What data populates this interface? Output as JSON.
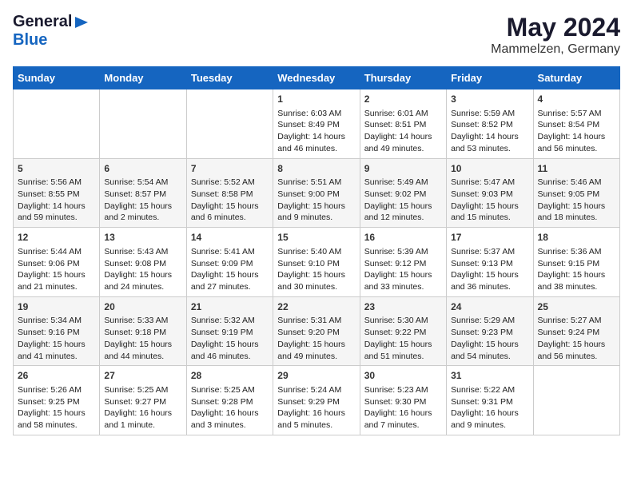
{
  "logo": {
    "general": "General",
    "blue": "Blue"
  },
  "title": "May 2024",
  "subtitle": "Mammelzen, Germany",
  "days_of_week": [
    "Sunday",
    "Monday",
    "Tuesday",
    "Wednesday",
    "Thursday",
    "Friday",
    "Saturday"
  ],
  "weeks": [
    [
      {
        "day": "",
        "info": ""
      },
      {
        "day": "",
        "info": ""
      },
      {
        "day": "",
        "info": ""
      },
      {
        "day": "1",
        "info": "Sunrise: 6:03 AM\nSunset: 8:49 PM\nDaylight: 14 hours and 46 minutes."
      },
      {
        "day": "2",
        "info": "Sunrise: 6:01 AM\nSunset: 8:51 PM\nDaylight: 14 hours and 49 minutes."
      },
      {
        "day": "3",
        "info": "Sunrise: 5:59 AM\nSunset: 8:52 PM\nDaylight: 14 hours and 53 minutes."
      },
      {
        "day": "4",
        "info": "Sunrise: 5:57 AM\nSunset: 8:54 PM\nDaylight: 14 hours and 56 minutes."
      }
    ],
    [
      {
        "day": "5",
        "info": "Sunrise: 5:56 AM\nSunset: 8:55 PM\nDaylight: 14 hours and 59 minutes."
      },
      {
        "day": "6",
        "info": "Sunrise: 5:54 AM\nSunset: 8:57 PM\nDaylight: 15 hours and 2 minutes."
      },
      {
        "day": "7",
        "info": "Sunrise: 5:52 AM\nSunset: 8:58 PM\nDaylight: 15 hours and 6 minutes."
      },
      {
        "day": "8",
        "info": "Sunrise: 5:51 AM\nSunset: 9:00 PM\nDaylight: 15 hours and 9 minutes."
      },
      {
        "day": "9",
        "info": "Sunrise: 5:49 AM\nSunset: 9:02 PM\nDaylight: 15 hours and 12 minutes."
      },
      {
        "day": "10",
        "info": "Sunrise: 5:47 AM\nSunset: 9:03 PM\nDaylight: 15 hours and 15 minutes."
      },
      {
        "day": "11",
        "info": "Sunrise: 5:46 AM\nSunset: 9:05 PM\nDaylight: 15 hours and 18 minutes."
      }
    ],
    [
      {
        "day": "12",
        "info": "Sunrise: 5:44 AM\nSunset: 9:06 PM\nDaylight: 15 hours and 21 minutes."
      },
      {
        "day": "13",
        "info": "Sunrise: 5:43 AM\nSunset: 9:08 PM\nDaylight: 15 hours and 24 minutes."
      },
      {
        "day": "14",
        "info": "Sunrise: 5:41 AM\nSunset: 9:09 PM\nDaylight: 15 hours and 27 minutes."
      },
      {
        "day": "15",
        "info": "Sunrise: 5:40 AM\nSunset: 9:10 PM\nDaylight: 15 hours and 30 minutes."
      },
      {
        "day": "16",
        "info": "Sunrise: 5:39 AM\nSunset: 9:12 PM\nDaylight: 15 hours and 33 minutes."
      },
      {
        "day": "17",
        "info": "Sunrise: 5:37 AM\nSunset: 9:13 PM\nDaylight: 15 hours and 36 minutes."
      },
      {
        "day": "18",
        "info": "Sunrise: 5:36 AM\nSunset: 9:15 PM\nDaylight: 15 hours and 38 minutes."
      }
    ],
    [
      {
        "day": "19",
        "info": "Sunrise: 5:34 AM\nSunset: 9:16 PM\nDaylight: 15 hours and 41 minutes."
      },
      {
        "day": "20",
        "info": "Sunrise: 5:33 AM\nSunset: 9:18 PM\nDaylight: 15 hours and 44 minutes."
      },
      {
        "day": "21",
        "info": "Sunrise: 5:32 AM\nSunset: 9:19 PM\nDaylight: 15 hours and 46 minutes."
      },
      {
        "day": "22",
        "info": "Sunrise: 5:31 AM\nSunset: 9:20 PM\nDaylight: 15 hours and 49 minutes."
      },
      {
        "day": "23",
        "info": "Sunrise: 5:30 AM\nSunset: 9:22 PM\nDaylight: 15 hours and 51 minutes."
      },
      {
        "day": "24",
        "info": "Sunrise: 5:29 AM\nSunset: 9:23 PM\nDaylight: 15 hours and 54 minutes."
      },
      {
        "day": "25",
        "info": "Sunrise: 5:27 AM\nSunset: 9:24 PM\nDaylight: 15 hours and 56 minutes."
      }
    ],
    [
      {
        "day": "26",
        "info": "Sunrise: 5:26 AM\nSunset: 9:25 PM\nDaylight: 15 hours and 58 minutes."
      },
      {
        "day": "27",
        "info": "Sunrise: 5:25 AM\nSunset: 9:27 PM\nDaylight: 16 hours and 1 minute."
      },
      {
        "day": "28",
        "info": "Sunrise: 5:25 AM\nSunset: 9:28 PM\nDaylight: 16 hours and 3 minutes."
      },
      {
        "day": "29",
        "info": "Sunrise: 5:24 AM\nSunset: 9:29 PM\nDaylight: 16 hours and 5 minutes."
      },
      {
        "day": "30",
        "info": "Sunrise: 5:23 AM\nSunset: 9:30 PM\nDaylight: 16 hours and 7 minutes."
      },
      {
        "day": "31",
        "info": "Sunrise: 5:22 AM\nSunset: 9:31 PM\nDaylight: 16 hours and 9 minutes."
      },
      {
        "day": "",
        "info": ""
      }
    ]
  ]
}
